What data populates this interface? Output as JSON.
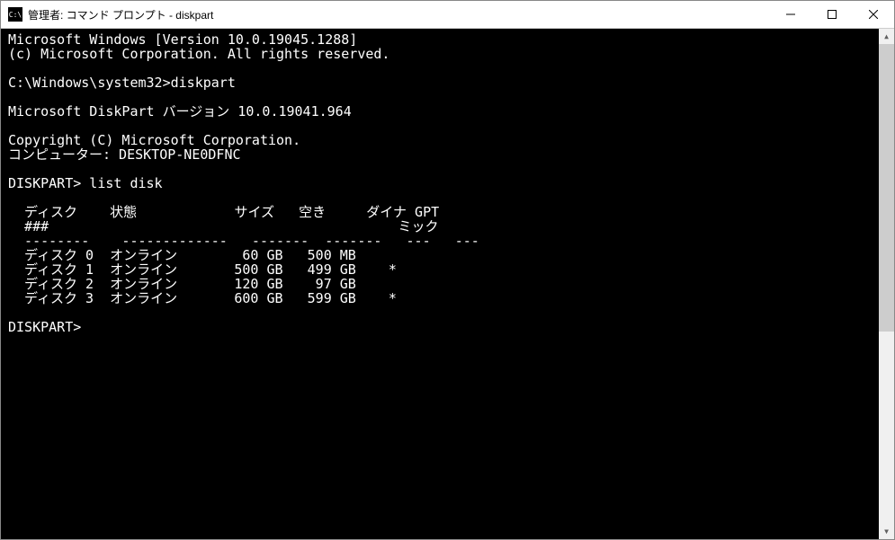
{
  "titlebar": {
    "icon_text": "C:\\",
    "title": "管理者: コマンド プロンプト - diskpart"
  },
  "terminal": {
    "line_version": "Microsoft Windows [Version 10.0.19045.1288]",
    "line_copyright": "(c) Microsoft Corporation. All rights reserved.",
    "blank": "",
    "prompt_path": "C:\\Windows\\system32>",
    "cmd_diskpart": "diskpart",
    "diskpart_version": "Microsoft DiskPart バージョン 10.0.19041.964",
    "diskpart_copyright": "Copyright (C) Microsoft Corporation.",
    "computer_label": "コンピューター: ",
    "computer_name": "DESKTOP-NE0DFNC",
    "diskpart_prompt": "DISKPART> ",
    "cmd_listdisk": "list disk",
    "header": {
      "disk": "  ディスク",
      "status": "状態",
      "size": "サイズ",
      "free": "空き",
      "dyn1": "ダイナ",
      "gpt": "GPT",
      "disknum": "  ###",
      "dyn2": "ミック"
    },
    "sep": {
      "disk": "  --------",
      "status": "-------------",
      "size": "-------",
      "free": "-------",
      "dyn": "---",
      "gpt": "---"
    },
    "rows": [
      {
        "disk": "  ディスク 0",
        "status": "オンライン",
        "size": "60 GB",
        "free": "500 MB",
        "dyn": "",
        "gpt": ""
      },
      {
        "disk": "  ディスク 1",
        "status": "オンライン",
        "size": "500 GB",
        "free": "499 GB",
        "dyn": "*",
        "gpt": ""
      },
      {
        "disk": "  ディスク 2",
        "status": "オンライン",
        "size": "120 GB",
        "free": "97 GB",
        "dyn": "",
        "gpt": ""
      },
      {
        "disk": "  ディスク 3",
        "status": "オンライン",
        "size": "600 GB",
        "free": "599 GB",
        "dyn": "*",
        "gpt": ""
      }
    ],
    "final_prompt": "DISKPART> "
  }
}
